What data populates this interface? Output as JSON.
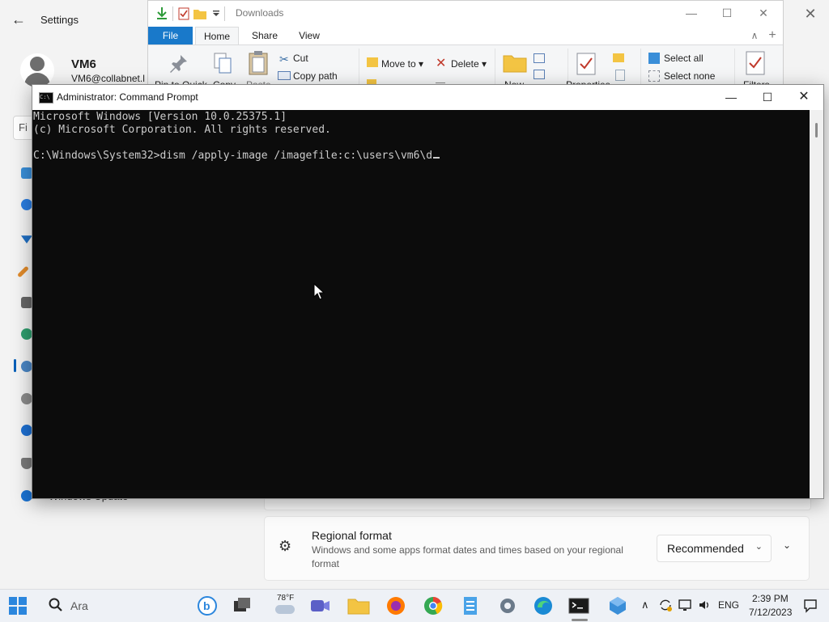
{
  "settings": {
    "back_glyph": "←",
    "title": "Settings",
    "close_glyph": "✕",
    "user": {
      "name": "VM6",
      "email": "VM6@collabnet.l"
    },
    "search_partial": "Fi",
    "nav_bottom_label": "Windows Update",
    "regional": {
      "icon_glyph": "⚙",
      "title": "Regional format",
      "description": "Windows and some apps format dates and times based on your regional format",
      "dropdown_value": "Recommended",
      "dropdown_glyph": "⌄",
      "expand_glyph": "⌄"
    }
  },
  "explorer": {
    "title": "Downloads",
    "tabs": {
      "file": "File",
      "home": "Home",
      "share": "Share",
      "view": "View"
    },
    "ribbon": {
      "pin": "Pin to Quick",
      "copy": "Copy",
      "paste": "Paste",
      "cut": "Cut",
      "copy_path": "Copy path",
      "move_to": "Move to",
      "delete": "Delete",
      "new": "New",
      "properties": "Properties",
      "select_all": "Select all",
      "select_none": "Select none",
      "filters": "Filters"
    },
    "controls": {
      "minimize": "—",
      "maximize": "☐",
      "close": "✕",
      "up": "∧",
      "add": "+"
    }
  },
  "cmd": {
    "title": "Administrator: Command Prompt",
    "icon_text": "C:\\",
    "lines": [
      "Microsoft Windows [Version 10.0.25375.1]",
      "(c) Microsoft Corporation. All rights reserved.",
      "",
      "C:\\Windows\\System32>dism /apply-image /imagefile:c:\\users\\vm6\\d"
    ],
    "controls": {
      "minimize": "—",
      "maximize": "☐",
      "close": "✕"
    }
  },
  "taskbar": {
    "search_placeholder": "Ara",
    "weather_temp": "78°F",
    "language": "ENG",
    "time": "2:39 PM",
    "date": "7/12/2023",
    "chevron": "∧"
  },
  "colors": {
    "accent": "#005fb8",
    "explorer_file_tab": "#1979ca",
    "console_bg": "#0c0c0c",
    "console_text": "#cccccc"
  }
}
